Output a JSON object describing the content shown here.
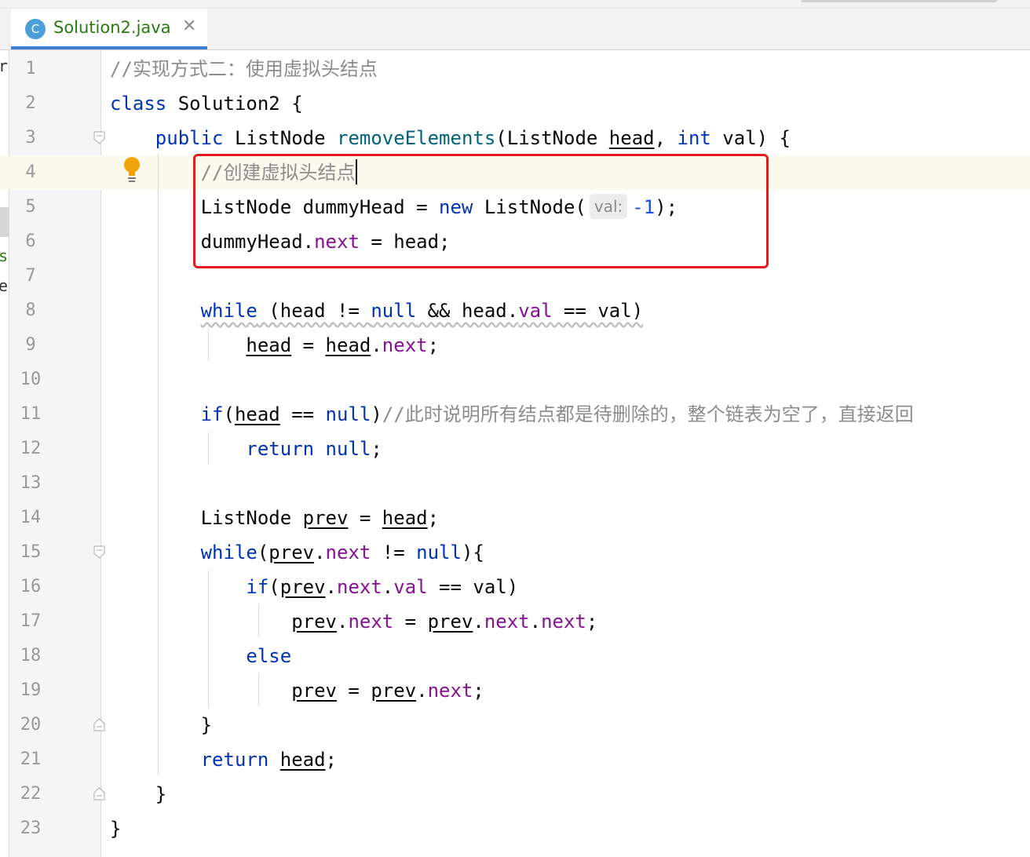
{
  "tab": {
    "icon_letter": "C",
    "filename": "Solution2.java",
    "close_glyph": "✕"
  },
  "left_edge": {
    "chars": [
      "r",
      "s",
      "e"
    ]
  },
  "editor": {
    "current_line": 4,
    "inlay_hint": "val:",
    "lines": [
      {
        "n": "1",
        "html": "<span class=\"cm\">//实现方式二：使用虚拟头结点</span>"
      },
      {
        "n": "2",
        "html": "<span class=\"kw\">class</span> Solution2 {"
      },
      {
        "n": "3",
        "html": "    <span class=\"kw\">public</span> ListNode <span class=\"mt\">removeElements</span>(ListNode <span class=\"u\">head</span>, <span class=\"kw\">int</span> val) {"
      },
      {
        "n": "4",
        "html": "        <span class=\"cm\">//创建虚拟头结点</span><span class=\"caret\"></span>"
      },
      {
        "n": "5",
        "html": "        ListNode dummyHead = <span class=\"kw\">new</span> ListNode(<span class=\"hint\" data-name=\"parameter-hint\">val:</span><span class=\"num\">-1</span>);"
      },
      {
        "n": "6",
        "html": "        dummyHead.<span class=\"fld\">next</span> = head;"
      },
      {
        "n": "7",
        "html": ""
      },
      {
        "n": "8",
        "html": "        <span class=\"warn\"><span class=\"kw\">while</span> (head != <span class=\"kw\">null</span> &amp;&amp; head.<span class=\"fld\">val</span> == val)</span>"
      },
      {
        "n": "9",
        "html": "            <span class=\"u\">head</span> = <span class=\"u\">head</span>.<span class=\"fld\">next</span>;"
      },
      {
        "n": "10",
        "html": ""
      },
      {
        "n": "11",
        "html": "        <span class=\"kw\">if</span>(<span class=\"u\">head</span> == <span class=\"kw\">null</span>)<span class=\"cm\">//此时说明所有结点都是待删除的，整个链表为空了，直接返回</span>"
      },
      {
        "n": "12",
        "html": "            <span class=\"kw\">return</span> <span class=\"kw\">null</span>;"
      },
      {
        "n": "13",
        "html": ""
      },
      {
        "n": "14",
        "html": "        ListNode <span class=\"u\">prev</span> = <span class=\"u\">head</span>;"
      },
      {
        "n": "15",
        "html": "        <span class=\"kw\">while</span>(<span class=\"u\">prev</span>.<span class=\"fld\">next</span> != <span class=\"kw\">null</span>){"
      },
      {
        "n": "16",
        "html": "            <span class=\"kw\">if</span>(<span class=\"u\">prev</span>.<span class=\"fld\">next</span>.<span class=\"fld\">val</span> == val)"
      },
      {
        "n": "17",
        "html": "                <span class=\"u\">prev</span>.<span class=\"fld\">next</span> = <span class=\"u\">prev</span>.<span class=\"fld\">next</span>.<span class=\"fld\">next</span>;"
      },
      {
        "n": "18",
        "html": "            <span class=\"kw\">else</span>"
      },
      {
        "n": "19",
        "html": "                <span class=\"u\">prev</span> = <span class=\"u\">prev</span>.<span class=\"fld\">next</span>;"
      },
      {
        "n": "20",
        "html": "        }"
      },
      {
        "n": "21",
        "html": "        <span class=\"kw\">return</span> <span class=\"u\">head</span>;"
      },
      {
        "n": "22",
        "html": "    }"
      },
      {
        "n": "23",
        "html": "}"
      }
    ],
    "fold_markers": [
      {
        "line": 3,
        "kind": "open"
      },
      {
        "line": 15,
        "kind": "open"
      },
      {
        "line": 20,
        "kind": "close"
      },
      {
        "line": 22,
        "kind": "close"
      }
    ],
    "gutter_icons": [
      "intention-bulb-icon"
    ],
    "highlight_box": {
      "from_line": 4,
      "to_line": 6,
      "color": "#e6191e"
    }
  },
  "colors": {
    "keyword": "#0033b3",
    "comment": "#8c8c8c",
    "field": "#871094",
    "method": "#00627a",
    "number": "#1750eb",
    "tab_title": "#2a7a0f",
    "tab_underline": "#3f7fd0"
  }
}
